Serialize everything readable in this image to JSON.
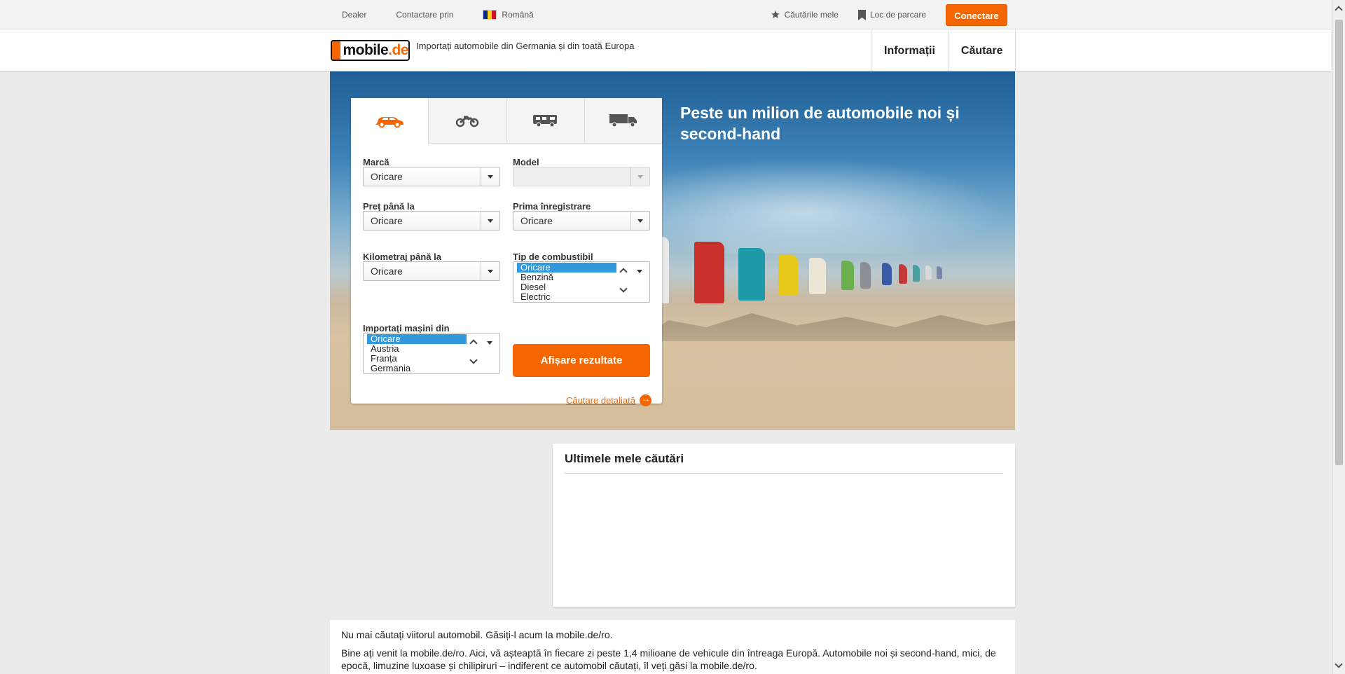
{
  "topbar": {
    "dealer": "Dealer",
    "contact": "Contactare prin",
    "language": "Română",
    "saved_searches": "Căutările mele",
    "parking": "Loc de parcare",
    "connect": "Conectare"
  },
  "header": {
    "logo_text": "mobile",
    "logo_suffix": ".de",
    "tagline": "Importați automobile din Germania și din toată Europa",
    "nav": [
      "Informații",
      "Căutare"
    ]
  },
  "hero": {
    "title": "Peste un milion de automobile noi și second-hand"
  },
  "search": {
    "tabs": [
      "car-icon",
      "motorbike-icon",
      "motorhome-icon",
      "truck-icon"
    ],
    "make_label": "Marcă",
    "make_value": "Oricare",
    "model_label": "Model",
    "model_value": "",
    "price_label": "Preț până la",
    "price_value": "Oricare",
    "registration_label": "Prima înregistrare",
    "registration_value": "Oricare",
    "mileage_label": "Kilometraj până la",
    "mileage_value": "Oricare",
    "fuel_label": "Tip de combustibil",
    "fuel_options": [
      "Oricare",
      "Benzină",
      "Diesel",
      "Electric"
    ],
    "import_label": "Importați mașini din",
    "import_options": [
      "Oricare",
      "Austria",
      "Franța",
      "Germania"
    ],
    "show_results": "Afișare rezultate",
    "advanced": "Căutare detaliată"
  },
  "last_searches": {
    "title": "Ultimele mele căutări"
  },
  "intro": {
    "line1": "Nu mai căutați viitorul automobil. Găsiți-l acum la mobile.de/ro.",
    "line2": "Bine ați venit la mobile.de/ro. Aici, vă așteaptă în fiecare zi peste 1,4 milioane de vehicule din întreaga Europă. Automobile noi și second-hand, mici, de epocă, limuzine luxoase și chilipiruri – indiferent ce automobil căutați, îl veți găsi la mobile.de/ro."
  },
  "colors": {
    "accent": "#f56600",
    "selection": "#3399dd"
  }
}
